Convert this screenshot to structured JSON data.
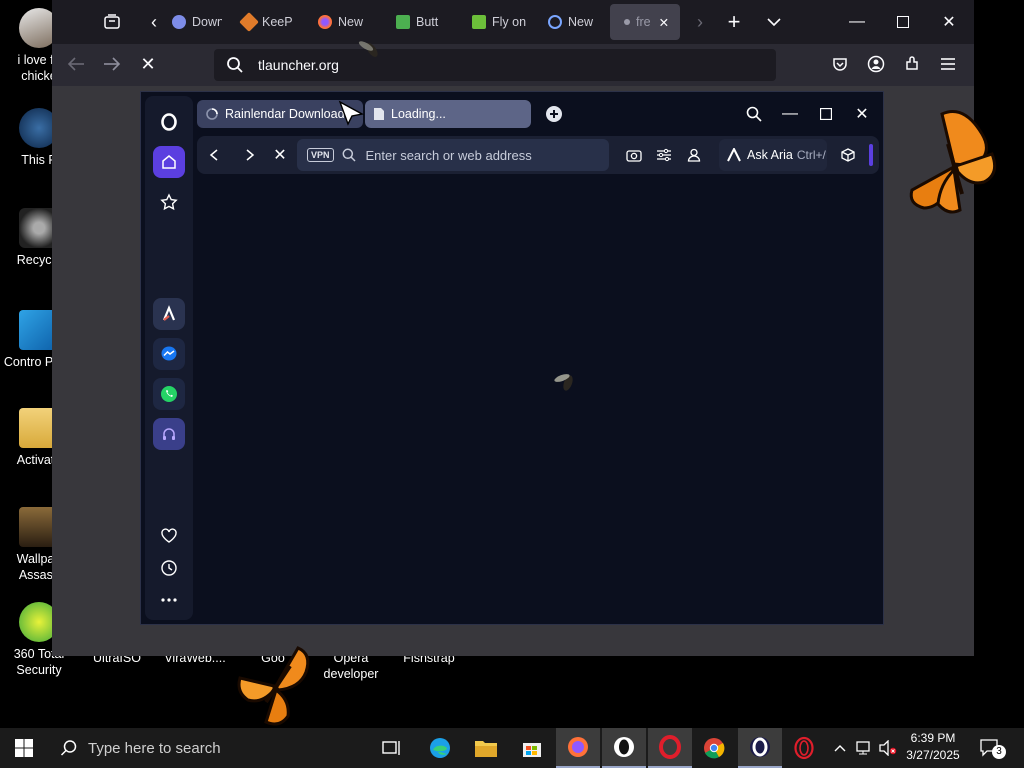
{
  "desktop": {
    "icons": [
      {
        "label": "i love fri chicke"
      },
      {
        "label": "This P"
      },
      {
        "label": "Recycle"
      },
      {
        "label": "Contro Pane"
      },
      {
        "label": "Activato"
      },
      {
        "label": "Wallpap Assass"
      },
      {
        "label": "360 Total Security"
      },
      {
        "label": "UltraISO"
      },
      {
        "label": "ViraWeb...."
      },
      {
        "label": "Goo"
      },
      {
        "label": "Opera developer"
      },
      {
        "label": "Fishstrap"
      }
    ]
  },
  "firefox": {
    "tabs": [
      {
        "label": "Down",
        "icon_color": "#7d8ce8"
      },
      {
        "label": "KeeP",
        "icon_color": "#e07b2a"
      },
      {
        "label": "New",
        "icon_color": "#ff7139"
      },
      {
        "label": "Butt",
        "icon_color": "#4caf50"
      },
      {
        "label": "Fly on",
        "icon_color": "#6cbf3a"
      },
      {
        "label": "New",
        "icon_color": "#7aa6ff"
      },
      {
        "label": "fre",
        "icon_color": "#9a9aa8"
      }
    ],
    "url": "tlauncher.org"
  },
  "opera": {
    "tabs": [
      {
        "label": "Rainlendar Download"
      },
      {
        "label": "Loading..."
      }
    ],
    "address_placeholder": "Enter search or web address",
    "vpn_label": "VPN",
    "aria_label": "Ask Aria",
    "aria_shortcut": "Ctrl+/"
  },
  "taskbar": {
    "search_placeholder": "Type here to search",
    "time": "6:39 PM",
    "date": "3/27/2025",
    "notifications": "3"
  },
  "colors": {
    "opera_accent": "#5b3fe0",
    "firefox_toolbar": "#2b2a33",
    "taskbar": "#1b1b1b"
  }
}
